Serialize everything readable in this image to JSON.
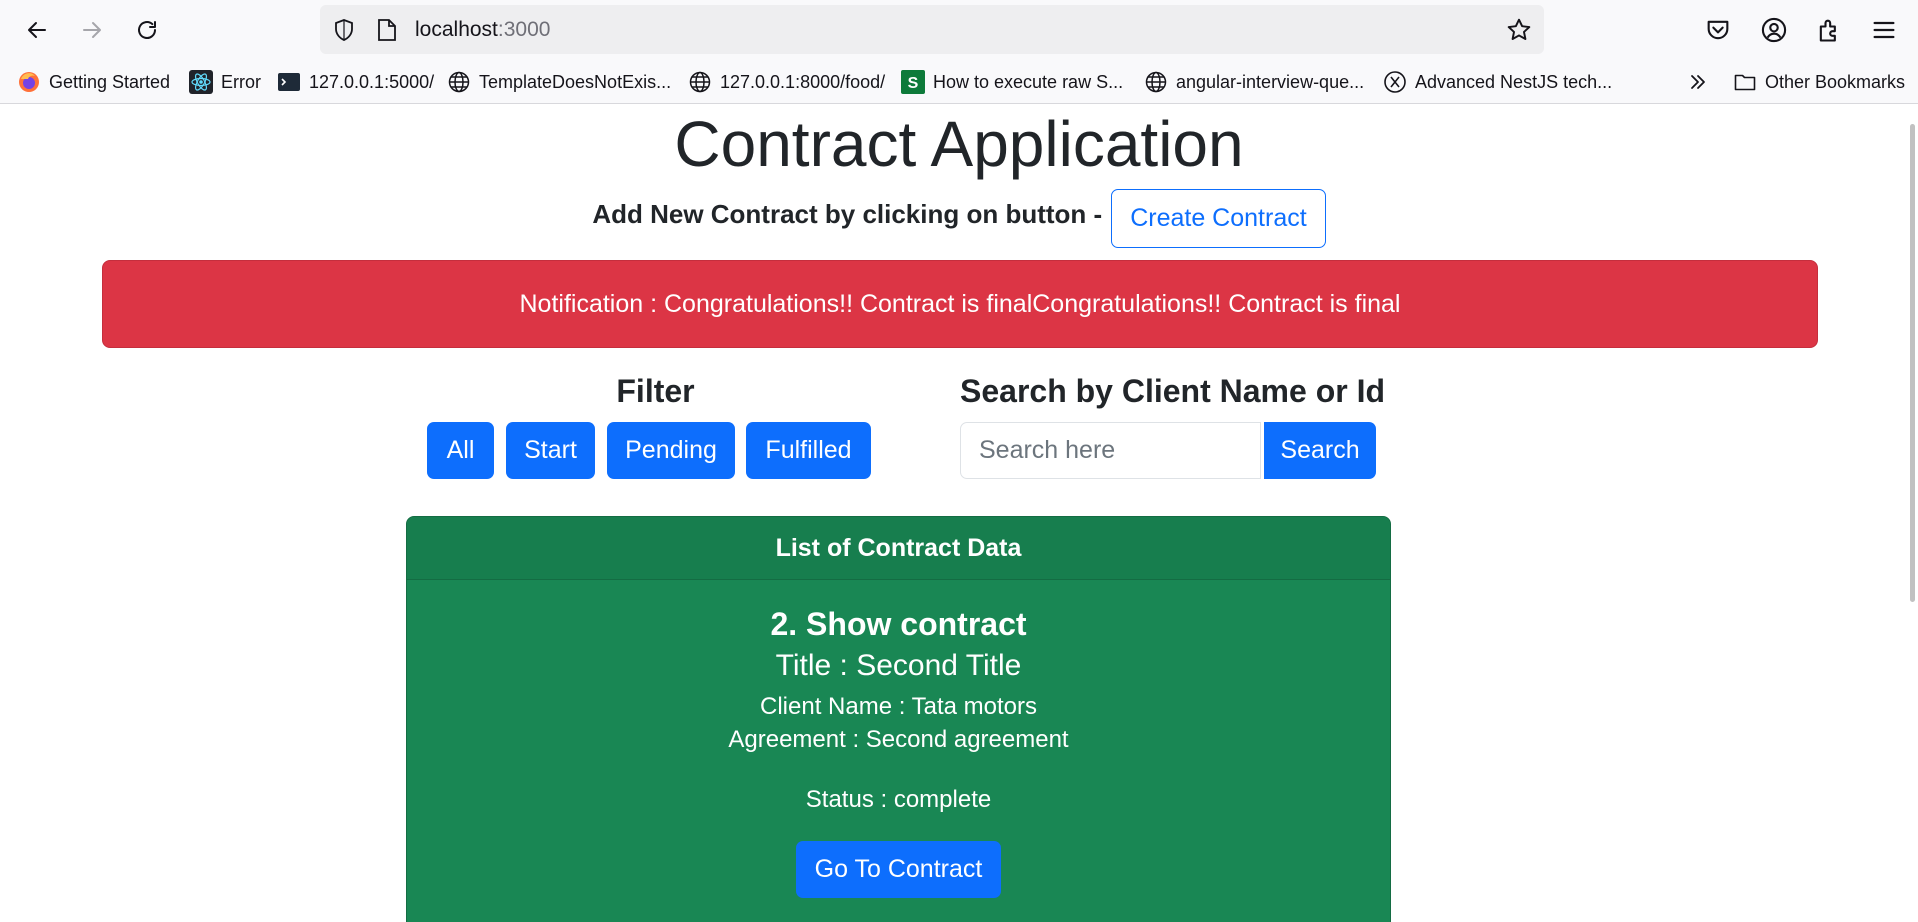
{
  "browser": {
    "url_host": "localhost",
    "url_port": ":3000",
    "bookmarks": [
      {
        "label": "Getting Started",
        "icon": "firefox-icon"
      },
      {
        "label": "Error",
        "icon": "react-icon"
      },
      {
        "label": "127.0.0.1:5000/",
        "icon": "terminal-icon"
      },
      {
        "label": "TemplateDoesNotExis...",
        "icon": "globe-icon"
      },
      {
        "label": "127.0.0.1:8000/food/",
        "icon": "globe-icon"
      },
      {
        "label": "How to execute raw S...",
        "icon": "s-logo-icon"
      },
      {
        "label": "angular-interview-que...",
        "icon": "globe-icon"
      },
      {
        "label": "Advanced NestJS tech...",
        "icon": "x-circle-icon"
      }
    ],
    "other_bookmarks": "Other Bookmarks"
  },
  "page": {
    "title": "Contract Application",
    "add_label": "Add New Contract by clicking on button -",
    "create_button": "Create Contract",
    "notification": "Notification : Congratulations!! Contract is finalCongratulations!! Contract is final"
  },
  "filter": {
    "title": "Filter",
    "buttons": [
      "All",
      "Start",
      "Pending",
      "Fulfilled"
    ]
  },
  "search": {
    "title": "Search by Client Name or Id",
    "placeholder": "Search here",
    "button": "Search"
  },
  "card": {
    "header": "List of Contract Data",
    "heading": "2. Show contract",
    "title": "Title : Second Title",
    "client": "Client Name : Tata motors",
    "agreement": "Agreement : Second agreement",
    "status": "Status : complete",
    "button": "Go To Contract"
  },
  "colors": {
    "primary": "#0d6efd",
    "danger": "#dc3545",
    "success": "#198754"
  }
}
